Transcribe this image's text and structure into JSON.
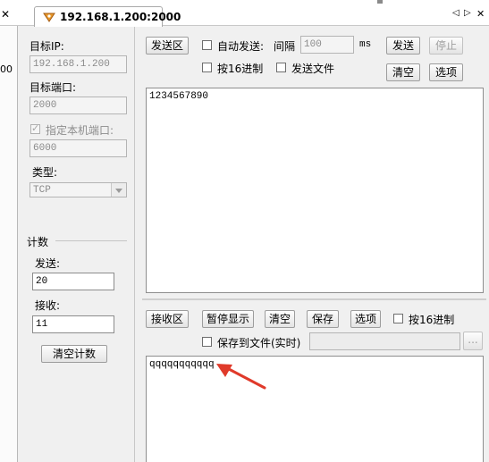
{
  "tab": {
    "title": "192.168.1.200:2000"
  },
  "left_fragment": {
    "text": "00"
  },
  "nav": {
    "prev": "◁",
    "next": "▷",
    "close": "✕"
  },
  "left": {
    "target_ip_label": "目标IP:",
    "target_ip_value": "192.168.1.200",
    "target_port_label": "目标端口:",
    "target_port_value": "2000",
    "local_port_label": "指定本机端口:",
    "local_port_value": "6000",
    "type_label": "类型:",
    "type_value": "TCP",
    "count_label": "计数",
    "send_label": "发送:",
    "send_value": "20",
    "recv_label": "接收:",
    "recv_value": "11",
    "clear_count_label": "清空计数"
  },
  "send": {
    "area_button": "发送区",
    "auto_send_label": "自动发送:",
    "interval_label": "间隔",
    "interval_value": "100",
    "interval_unit": "ms",
    "send_button": "发送",
    "stop_button": "停止",
    "hex_label": "按16进制",
    "send_file_label": "发送文件",
    "clear_button": "清空",
    "options_button": "选项",
    "content": "1234567890"
  },
  "recv": {
    "area_button": "接收区",
    "pause_button": "暂停显示",
    "clear_button": "清空",
    "save_button": "保存",
    "options_button": "选项",
    "hex_label": "按16进制",
    "save_file_label": "保存到文件(实时)",
    "browse_button": "...",
    "content": "qqqqqqqqqqq"
  },
  "colors": {
    "arrow": "#e03a2a",
    "tab_icon": "#d27a1a"
  }
}
